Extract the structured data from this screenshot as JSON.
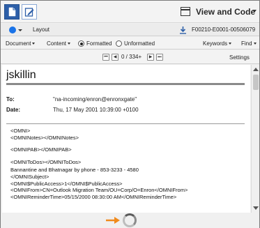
{
  "toolbar": {
    "view_title": "View and Code",
    "icons": [
      "document-icon",
      "edit-document-icon",
      "view-window-icon"
    ]
  },
  "layoutrow": {
    "layout_label": "Layout",
    "doc_id": "F00210-E0001-00506079",
    "colors": {
      "selector_dot": "#1a73e8"
    }
  },
  "menurow": {
    "document": "Document",
    "content": "Content",
    "formatted": "Formatted",
    "unformatted": "Unformatted",
    "formatted_selected": true,
    "keywords": "Keywords",
    "find": "Find"
  },
  "nav": {
    "page_counter": "0 / 334+",
    "settings": "Settings"
  },
  "email": {
    "sender": "jskillin",
    "to_label": "To:",
    "to_value": "\"na-incoming/enron@enronxgate\"",
    "date_label": "Date:",
    "date_value": "Thu, 17 May 2001 10:39:00 +0100",
    "body": [
      "<OMNI>",
      "<OMNINotes></OMNINotes>",
      "<OMNIPAB></OMNIPAB>",
      "<OMNIToDos></OMNIToDos>",
      "Bannantine and Bhatnagar by phone - 853-3233 - 4580",
      "</OMNISubject>",
      "<OMNI$PublicAccess>1</OMNI$PublicAccess>",
      "<OMNIFrom>CN=Outlook Migration Team/OU=Corp/O=Enron</OMNIFrom>",
      "<OMNIReminderTime>05/15/2000 08:30:00 AM</OMNIReminderTime>"
    ]
  },
  "loading": {
    "colors": {
      "arrow": "#f08a1c"
    }
  }
}
